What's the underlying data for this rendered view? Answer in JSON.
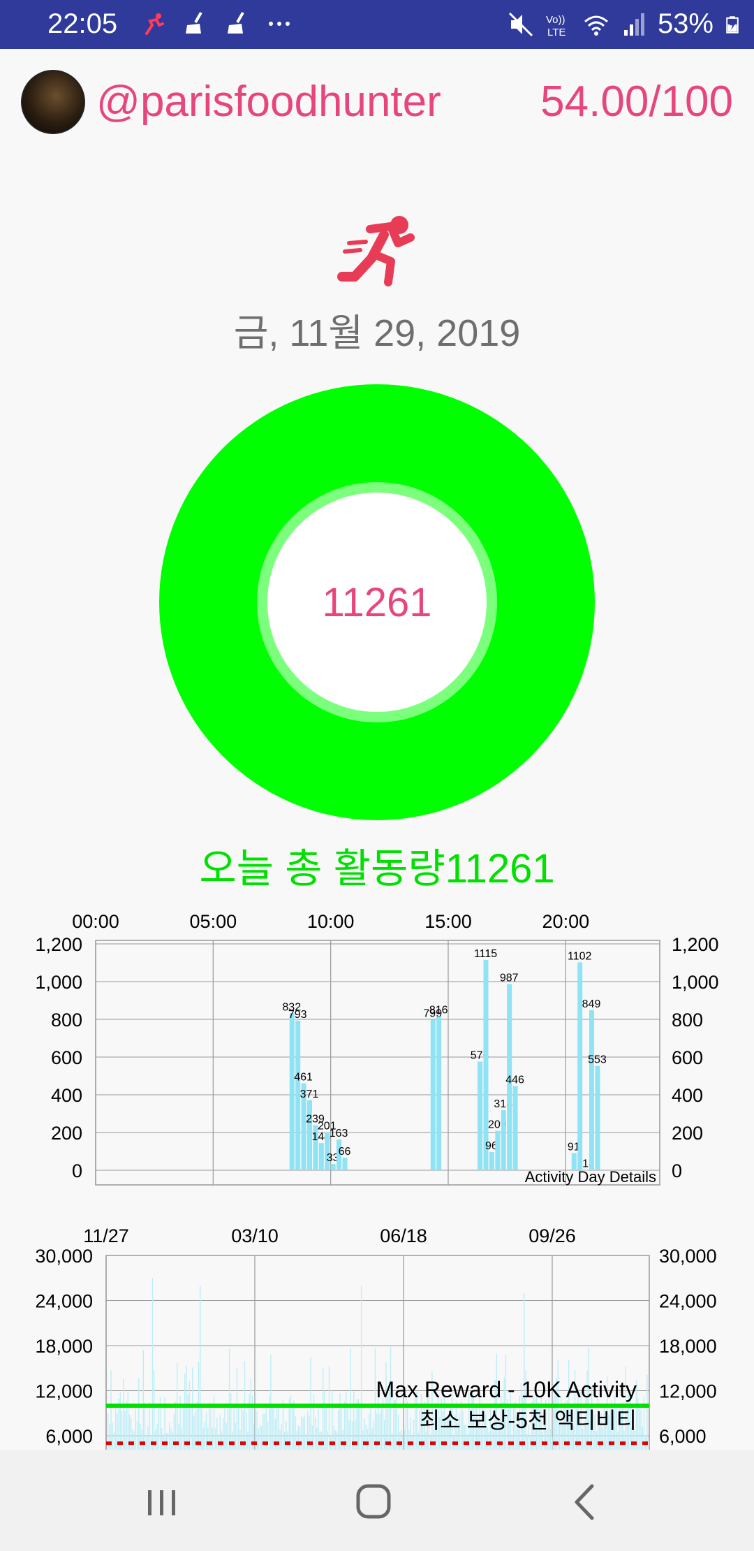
{
  "status_bar": {
    "time": "22:05",
    "battery": "53%",
    "left_icons": [
      "runner-notification-icon",
      "broom-icon",
      "broom-icon",
      "more-dots-icon"
    ],
    "right_icons": [
      "mute-icon",
      "volte-icon",
      "wifi-icon",
      "signal-icon",
      "battery-charging-icon"
    ],
    "accent_color": "#2f3a9a"
  },
  "profile": {
    "username": "@parisfoodhunter",
    "score": "54.00/100"
  },
  "activity": {
    "date": "금, 11월 29, 2019",
    "ring_value": "11261",
    "total_label": "오늘 총 활동량11261",
    "ring_color": "#00ff00",
    "ring_inner_color": "#7cff7c"
  },
  "chart_data": [
    {
      "type": "bar",
      "legend": "Activity Day Details",
      "x_tick_labels": [
        "00:00",
        "05:00",
        "10:00",
        "15:00",
        "20:00"
      ],
      "y_tick_labels": [
        "1,200",
        "1,000",
        "800",
        "600",
        "400",
        "200",
        "0"
      ],
      "ylim": [
        0,
        1200
      ],
      "xlim_hours": [
        0,
        24
      ],
      "grid": true,
      "bar_color": "#8ee3f5",
      "bars": [
        {
          "t": 8.25,
          "value": 832,
          "label": "832"
        },
        {
          "t": 8.5,
          "value": 793,
          "label": "793"
        },
        {
          "t": 8.75,
          "value": 461,
          "label": "461"
        },
        {
          "t": 9.0,
          "value": 371,
          "label": "371"
        },
        {
          "t": 9.25,
          "value": 239,
          "label": "239"
        },
        {
          "t": 9.5,
          "value": 144,
          "label": "144"
        },
        {
          "t": 9.75,
          "value": 201,
          "label": "201"
        },
        {
          "t": 10.0,
          "value": 33,
          "label": "33"
        },
        {
          "t": 10.25,
          "value": 163,
          "label": "163"
        },
        {
          "t": 10.5,
          "value": 66,
          "label": "66"
        },
        {
          "t": 14.25,
          "value": 799,
          "label": "799"
        },
        {
          "t": 14.5,
          "value": 816,
          "label": "816"
        },
        {
          "t": 16.25,
          "value": 576,
          "label": "576"
        },
        {
          "t": 16.5,
          "value": 1115,
          "label": "1115"
        },
        {
          "t": 16.75,
          "value": 96,
          "label": "96"
        },
        {
          "t": 17.0,
          "value": 209,
          "label": "209"
        },
        {
          "t": 17.25,
          "value": 318,
          "label": "318"
        },
        {
          "t": 17.5,
          "value": 987,
          "label": "987"
        },
        {
          "t": 17.75,
          "value": 446,
          "label": "446"
        },
        {
          "t": 20.25,
          "value": 91,
          "label": "91"
        },
        {
          "t": 20.5,
          "value": 1102,
          "label": "1102"
        },
        {
          "t": 20.75,
          "value": 1,
          "label": "1"
        },
        {
          "t": 21.0,
          "value": 849,
          "label": "849"
        },
        {
          "t": 21.25,
          "value": 553,
          "label": "553"
        }
      ]
    },
    {
      "type": "bar",
      "x_tick_labels": [
        "11/27",
        "03/10",
        "06/18",
        "09/26"
      ],
      "y_tick_labels": [
        "30,000",
        "24,000",
        "18,000",
        "12,000",
        "6,000"
      ],
      "ylim": [
        6000,
        30000
      ],
      "grid": true,
      "bar_color": "#bdeef8",
      "reference_lines": [
        {
          "label": "Max Reward - 10K Activity",
          "value": 10000,
          "color": "#00e000",
          "style": "solid"
        },
        {
          "label": "최소 보상-5천 액티비티",
          "value": 5000,
          "color": "#e00000",
          "style": "dashed"
        }
      ],
      "highlight_values": [
        27000,
        26000,
        26000,
        25000,
        24000
      ]
    }
  ],
  "nav_bar": {
    "recents_icon": "recents-icon",
    "home_icon": "home-icon",
    "back_icon": "back-icon"
  }
}
